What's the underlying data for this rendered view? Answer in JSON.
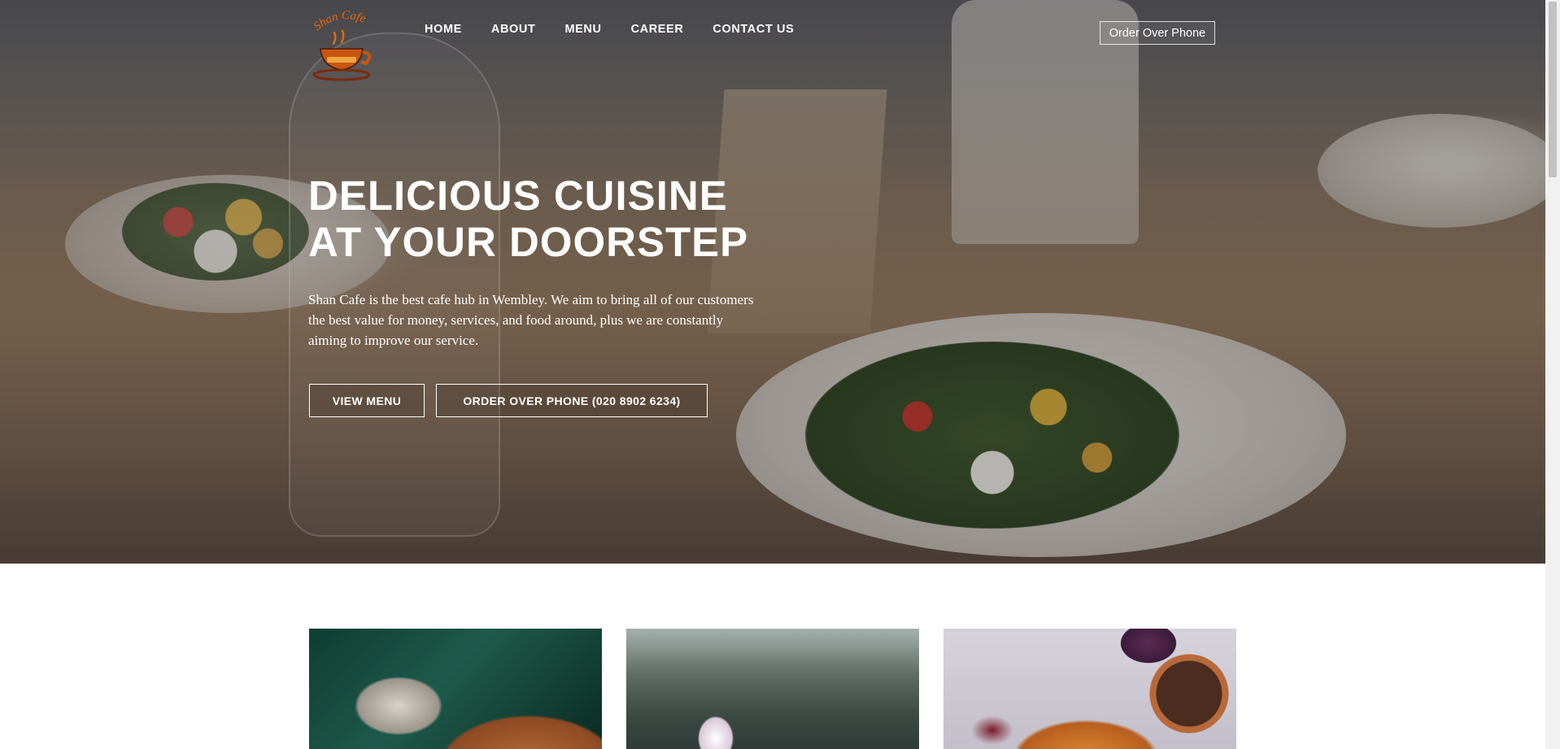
{
  "brand": {
    "logo_text": "Shan Cafe",
    "colors": {
      "logo_orange": "#e06a12",
      "overlay": "#14141c"
    }
  },
  "nav": {
    "items": [
      {
        "label": "HOME",
        "active": true
      },
      {
        "label": "ABOUT"
      },
      {
        "label": "MENU"
      },
      {
        "label": "CAREER"
      },
      {
        "label": "CONTACT US"
      }
    ],
    "order_button": "Order Over Phone"
  },
  "hero": {
    "title_line1": "DELICIOUS CUISINE",
    "title_line2": "AT YOUR DOORSTEP",
    "description": "Shan Cafe is the best cafe hub in Wembley. We aim to bring all of our customers the best value for money, services, and food around, plus we are constantly aiming to improve our service.",
    "buttons": {
      "view_menu": "VIEW MENU",
      "order_phone": "ORDER OVER PHONE (020 8902 6234)"
    }
  },
  "cards": [
    {
      "image": "latte-art-coffee"
    },
    {
      "image": "restaurant-table-glass"
    },
    {
      "image": "curry-and-vegetables"
    }
  ],
  "icons": {
    "logo": "coffee-cup-icon"
  }
}
